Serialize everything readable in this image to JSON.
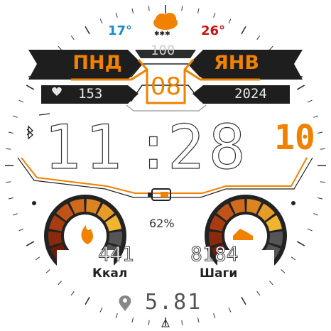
{
  "weather": {
    "temp_low": "17°",
    "temp_high": "26°",
    "humidity": "100",
    "icon": "cloud-snow-icon",
    "low_color": "#1a8ccc",
    "high_color": "#c81414"
  },
  "date": {
    "weekday": "ПНД",
    "day": "08",
    "month": "ЯНВ",
    "year": "2024"
  },
  "heart_rate": {
    "value": "153",
    "icon": "heart-icon"
  },
  "time": {
    "hours": "11",
    "minutes": "28",
    "seconds": "10",
    "separator": ":"
  },
  "battery": {
    "percent": "62%",
    "level": 0.62,
    "icon": "battery-icon"
  },
  "calories": {
    "value": "441",
    "label": "Ккал",
    "icon": "flame-icon",
    "segments_lit": 8
  },
  "steps": {
    "value": "8184",
    "label": "Шаги",
    "icon": "shoe-icon",
    "segments_lit": 8
  },
  "distance": {
    "value": "5.81",
    "icon": "location-pin-icon"
  },
  "status": {
    "bluetooth_icon": "bluetooth-icon"
  },
  "colors": {
    "accent": "#f08200",
    "text": "#222222"
  }
}
